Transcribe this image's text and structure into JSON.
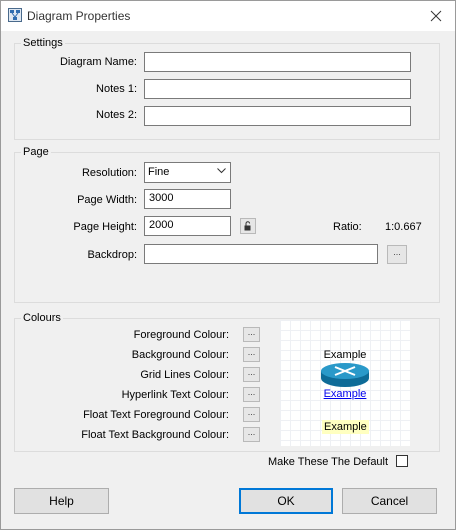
{
  "window": {
    "title": "Diagram Properties"
  },
  "settings": {
    "legend": "Settings",
    "diagram_name_label": "Diagram Name:",
    "diagram_name_value": "",
    "notes1_label": "Notes 1:",
    "notes1_value": "",
    "notes2_label": "Notes 2:",
    "notes2_value": ""
  },
  "page": {
    "legend": "Page",
    "resolution_label": "Resolution:",
    "resolution_value": "Fine",
    "width_label": "Page Width:",
    "width_value": "3000",
    "height_label": "Page Height:",
    "height_value": "2000",
    "ratio_label": "Ratio:",
    "ratio_value": "1:0.667",
    "backdrop_label": "Backdrop:",
    "backdrop_value": "",
    "browse_label": "..."
  },
  "colours": {
    "legend": "Colours",
    "dots": "...",
    "items": [
      "Foreground Colour:",
      "Background Colour:",
      "Grid Lines Colour:",
      "Hyperlink Text Colour:",
      "Float Text Foreground Colour:",
      "Float Text Background Colour:"
    ],
    "preview": {
      "label": "Example",
      "hyperlink": "Example",
      "float_text": "Example",
      "hyperlink_color": "#0000ee",
      "float_bg_color": "#ffffc0"
    }
  },
  "default_checkbox": {
    "label": "Make These The Default",
    "checked": false
  },
  "buttons": {
    "help": "Help",
    "ok": "OK",
    "cancel": "Cancel"
  }
}
